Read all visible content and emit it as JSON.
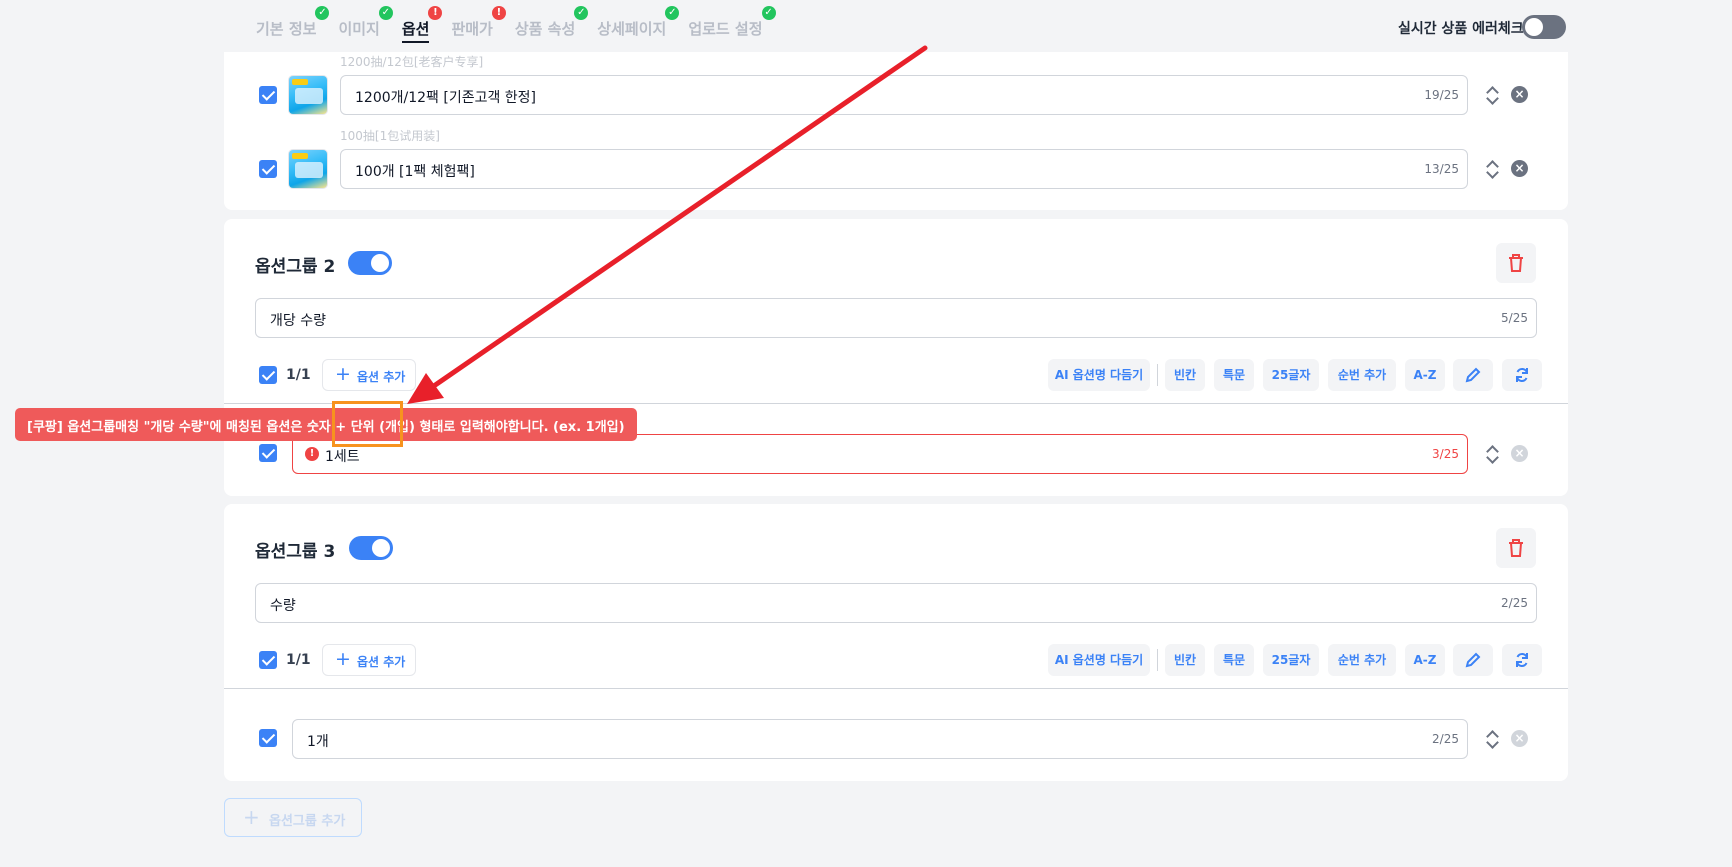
{
  "tabs": [
    {
      "label": "기본 정보",
      "status": "ok"
    },
    {
      "label": "이미지",
      "status": "ok"
    },
    {
      "label": "옵션",
      "status": "error",
      "active": true
    },
    {
      "label": "판매가",
      "status": "error"
    },
    {
      "label": "상품 속성",
      "status": "ok"
    },
    {
      "label": "상세페이지",
      "status": "ok"
    },
    {
      "label": "업로드 설정",
      "status": "ok"
    }
  ],
  "realtime_check": {
    "label": "실시간 상품 에러체크",
    "enabled": false
  },
  "group1": {
    "options": [
      {
        "hint": "1200抽/12包[老客户专享]",
        "value": "1200개/12팩 [기존고객 한정]",
        "count": "19/25",
        "checked": true
      },
      {
        "hint": "100抽[1包试用装]",
        "value": "100개 [1팩 체험팩]",
        "count": "13/25",
        "checked": true
      }
    ]
  },
  "group2": {
    "title": "옵션그룹 2",
    "enabled": true,
    "name_value": "개당 수량",
    "name_count": "5/25",
    "selected_count": "1/1",
    "add_option": "옵션 추가",
    "options": [
      {
        "value": "1세트",
        "count": "3/25",
        "checked": true,
        "error": true
      }
    ]
  },
  "group3": {
    "title": "옵션그룹 3",
    "enabled": true,
    "name_value": "수량",
    "name_count": "2/25",
    "selected_count": "1/1",
    "add_option": "옵션 추가",
    "options": [
      {
        "value": "1개",
        "count": "2/25",
        "checked": true,
        "error": false
      }
    ]
  },
  "toolbar": {
    "ai_label": "AI 옵션명 다듬기",
    "blank_label": "빈칸",
    "special_label": "특문",
    "chars25_label": "25글자",
    "seq_label": "순번 추가",
    "az_label": "A-Z",
    "edit_icon": "pencil-icon",
    "refresh_icon": "refresh-icon"
  },
  "error_tooltip": "[쿠팡] 옵션그룹매칭 \"개당 수량\"에 매칭된 옵션은 숫자 + 단위 (개입) 형태로 입력해야합니다. (ex. 1개입)",
  "add_group_label": "옵션그룹 추가",
  "colors": {
    "accent": "#3b82f6",
    "error": "#ef4444",
    "success": "#22c55e",
    "highlight": "#f7931e",
    "annotation_arrow": "#e8202a"
  }
}
